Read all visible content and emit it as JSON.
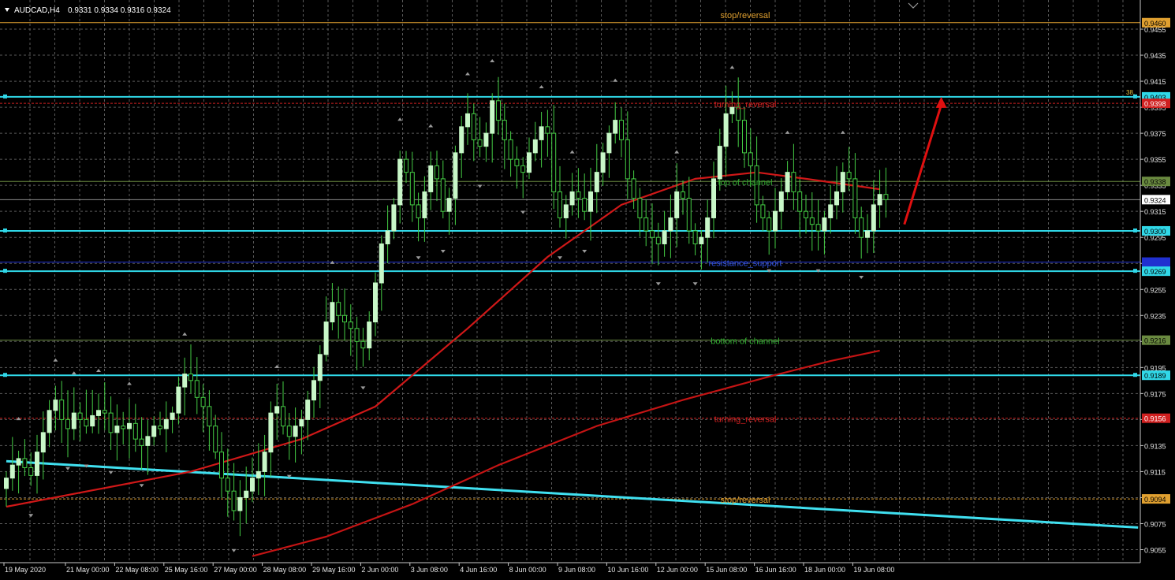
{
  "header": {
    "symbol": "AUDCAD,H4",
    "ohlc": "0.9331 0.9334 0.9316 0.9324"
  },
  "colors": {
    "background": "#000000",
    "grid": "#5a5a5a",
    "candle_bull": "#c8f7c8",
    "candle_bear_wick": "#44cc44",
    "ma_fast": "#d01818",
    "ma_slow": "#c41414",
    "cyan": "#30d8e8",
    "label_red": "#d02020",
    "label_green": "#2fa82f",
    "label_orange": "#e0a030",
    "label_blue": "#3050e0",
    "trendline": "#40e0f0",
    "arrow": "#e01010",
    "fractal": "#9a9a9a"
  },
  "chart_data": {
    "type": "candlestick",
    "symbol": "AUDCAD",
    "timeframe": "H4",
    "ylim": [
      0.9045,
      0.9475
    ],
    "y_ticks": [
      "0.9455",
      "0.9435",
      "0.9415",
      "0.9395",
      "0.9375",
      "0.9355",
      "0.9335",
      "0.9315",
      "0.9295",
      "0.9275",
      "0.9255",
      "0.9235",
      "0.9215",
      "0.9195",
      "0.9175",
      "0.9155",
      "0.9135",
      "0.9115",
      "0.9095",
      "0.9075",
      "0.9055"
    ],
    "x_ticks": [
      {
        "label": "19 May 2020",
        "index": 0
      },
      {
        "label": "21 May 00:00",
        "index": 10
      },
      {
        "label": "22 May 08:00",
        "index": 18
      },
      {
        "label": "25 May 16:00",
        "index": 26
      },
      {
        "label": "27 May 00:00",
        "index": 34
      },
      {
        "label": "28 May 08:00",
        "index": 42
      },
      {
        "label": "29 May 16:00",
        "index": 50
      },
      {
        "label": "2 Jun 00:00",
        "index": 58
      },
      {
        "label": "3 Jun 08:00",
        "index": 66
      },
      {
        "label": "4 Jun 16:00",
        "index": 74
      },
      {
        "label": "8 Jun 00:00",
        "index": 82
      },
      {
        "label": "9 Jun 08:00",
        "index": 90
      },
      {
        "label": "10 Jun 16:00",
        "index": 98
      },
      {
        "label": "12 Jun 00:00",
        "index": 106
      },
      {
        "label": "15 Jun 08:00",
        "index": 114
      },
      {
        "label": "16 Jun 16:00",
        "index": 122
      },
      {
        "label": "18 Jun 00:00",
        "index": 130
      },
      {
        "label": "19 Jun 08:00",
        "index": 138
      }
    ],
    "last_price": 0.9324,
    "closes": [
      0.911,
      0.912,
      0.9125,
      0.9118,
      0.9112,
      0.913,
      0.9145,
      0.9162,
      0.917,
      0.9155,
      0.9148,
      0.916,
      0.9155,
      0.915,
      0.9158,
      0.9162,
      0.916,
      0.9145,
      0.915,
      0.9148,
      0.9152,
      0.914,
      0.9135,
      0.9142,
      0.915,
      0.9148,
      0.9155,
      0.916,
      0.918,
      0.919,
      0.9185,
      0.9172,
      0.9165,
      0.915,
      0.913,
      0.911,
      0.91,
      0.9085,
      0.9095,
      0.91,
      0.911,
      0.9115,
      0.913,
      0.916,
      0.9165,
      0.915,
      0.9142,
      0.915,
      0.9155,
      0.917,
      0.9185,
      0.9205,
      0.923,
      0.9245,
      0.9235,
      0.923,
      0.9225,
      0.9215,
      0.921,
      0.923,
      0.926,
      0.929,
      0.93,
      0.932,
      0.9355,
      0.9345,
      0.932,
      0.931,
      0.933,
      0.935,
      0.934,
      0.9315,
      0.9325,
      0.936,
      0.938,
      0.939,
      0.937,
      0.9365,
      0.9375,
      0.94,
      0.9385,
      0.937,
      0.9355,
      0.935,
      0.9345,
      0.936,
      0.937,
      0.938,
      0.9375,
      0.933,
      0.931,
      0.932,
      0.933,
      0.9325,
      0.9315,
      0.933,
      0.9345,
      0.936,
      0.9375,
      0.9385,
      0.937,
      0.934,
      0.9325,
      0.931,
      0.93,
      0.9295,
      0.929,
      0.93,
      0.931,
      0.933,
      0.9325,
      0.93,
      0.929,
      0.9295,
      0.931,
      0.934,
      0.9365,
      0.939,
      0.9395,
      0.9385,
      0.936,
      0.935,
      0.932,
      0.931,
      0.93,
      0.9315,
      0.933,
      0.9345,
      0.933,
      0.9315,
      0.931,
      0.9305,
      0.93,
      0.931,
      0.932,
      0.933,
      0.9345,
      0.934,
      0.931,
      0.9295,
      0.93,
      0.932,
      0.9328,
      0.9324
    ],
    "ma_fast": [
      [
        0,
        0.9088
      ],
      [
        30,
        0.9115
      ],
      [
        48,
        0.914
      ],
      [
        60,
        0.9165
      ],
      [
        75,
        0.9225
      ],
      [
        88,
        0.928
      ],
      [
        100,
        0.932
      ],
      [
        112,
        0.934
      ],
      [
        122,
        0.9345
      ],
      [
        130,
        0.934
      ],
      [
        142,
        0.9332
      ]
    ],
    "ma_slow": [
      [
        40,
        0.905
      ],
      [
        52,
        0.9065
      ],
      [
        66,
        0.909
      ],
      [
        80,
        0.912
      ],
      [
        96,
        0.915
      ],
      [
        110,
        0.917
      ],
      [
        124,
        0.9188
      ],
      [
        134,
        0.92
      ],
      [
        142,
        0.9208
      ]
    ],
    "trendline": {
      "from": [
        0,
        0.9123
      ],
      "to": [
        184,
        0.9072
      ]
    },
    "levels": [
      {
        "price": 0.946,
        "tag": "0.9460",
        "color": "#e0a030",
        "label": "stop/reversal",
        "label_color": "#e0a030",
        "style": "solid"
      },
      {
        "price": 0.9403,
        "tag": "0.9403",
        "color": "#30d8e8",
        "label": "",
        "style": "solid",
        "thick": true,
        "note": "38."
      },
      {
        "price": 0.9398,
        "tag": "0.9398",
        "color": "#d02020",
        "label": "turning_reversal",
        "label_color": "#d02020",
        "style": "dashed"
      },
      {
        "price": 0.9338,
        "tag": "0.9338",
        "color": "#6a8a40",
        "label": "top of channel",
        "label_color": "#2fa82f",
        "style": "solid"
      },
      {
        "price": 0.93,
        "tag": "0.9300",
        "color": "#30d8e8",
        "label": "",
        "style": "solid",
        "thick": true
      },
      {
        "price": 0.9276,
        "tag": "",
        "color": "#2030d0",
        "label": "resistance_support",
        "label_color": "#3050e0",
        "style": "solid"
      },
      {
        "price": 0.9269,
        "tag": "0.9269",
        "color": "#30d8e8",
        "label": "",
        "style": "solid",
        "thick": true
      },
      {
        "price": 0.9216,
        "tag": "0.9216",
        "color": "#6a8a40",
        "label": "bottom of channel",
        "label_color": "#2fa82f",
        "style": "solid"
      },
      {
        "price": 0.9189,
        "tag": "0.9189",
        "color": "#30d8e8",
        "label": "",
        "style": "solid",
        "thick": true
      },
      {
        "price": 0.9156,
        "tag": "0.9156",
        "color": "#d02020",
        "label": "turning_reversal",
        "label_color": "#d02020",
        "style": "dashed"
      },
      {
        "price": 0.9094,
        "tag": "0.9094",
        "color": "#e0a030",
        "label": "stop/reversal",
        "label_color": "#e0a030",
        "style": "dashed"
      }
    ],
    "last_price_tag": "0.9324",
    "arrow": {
      "from": [
        146,
        0.9305
      ],
      "to": [
        152,
        0.9403
      ]
    }
  }
}
